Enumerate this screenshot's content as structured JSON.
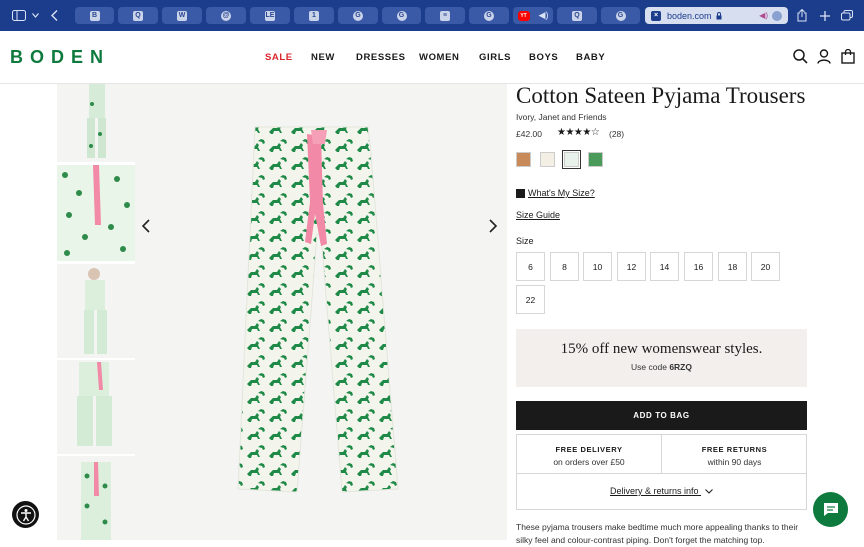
{
  "browser": {
    "address": "boden.com",
    "icons": [
      "sidebar-icon",
      "chevron-down-icon",
      "back-icon",
      "share-icon",
      "new-tab-icon",
      "tab-overview-icon"
    ],
    "tabs": [
      {
        "favicon": "B"
      },
      {
        "favicon": "Q"
      },
      {
        "favicon": "W"
      },
      {
        "favicon": "@"
      },
      {
        "favicon": "LE"
      },
      {
        "favicon": "1"
      },
      {
        "favicon": "G"
      },
      {
        "favicon": "G"
      },
      {
        "favicon": "≡"
      },
      {
        "favicon": "G"
      },
      {
        "favicon": "YT"
      },
      {
        "favicon": "Q"
      },
      {
        "favicon": "G"
      }
    ]
  },
  "header": {
    "logo": "BODEN",
    "nav": [
      "SALE",
      "NEW",
      "DRESSES",
      "WOMEN",
      "GIRLS",
      "BOYS",
      "BABY"
    ],
    "brand_color": "#0f7a3e",
    "sale_color": "#d9262f"
  },
  "product": {
    "title": "Cotton Sateen Pyjama Trousers",
    "colour": "Ivory, Janet and Friends",
    "price": "£42.00",
    "rating": 4.5,
    "stars": "★★★★☆",
    "reviews": "(28)",
    "what_size": "What's My Size?",
    "size_guide": "Size Guide",
    "size_label": "Size",
    "sizes": [
      "6",
      "8",
      "10",
      "12",
      "14",
      "16",
      "18",
      "20",
      "22"
    ],
    "swatch_colors": [
      "#c98a5a",
      "#f3efe4",
      "#e8f1ea",
      "#4a9a5a"
    ]
  },
  "promo": {
    "headline": "15% off new womenswear styles.",
    "code_prefix": "Use code",
    "code": "6RZQ"
  },
  "cart": {
    "add_to_bag": "ADD TO BAG"
  },
  "delivery": {
    "free_delivery_title": "FREE DELIVERY",
    "free_delivery_sub": "on orders over £50",
    "free_returns_title": "FREE RETURNS",
    "free_returns_sub": "within 90 days",
    "info_link": "Delivery & returns info"
  },
  "description": "These pyjama trousers make bedtime much more appealing thanks to their silky feel and colour-contrast piping. Don't forget the matching top."
}
